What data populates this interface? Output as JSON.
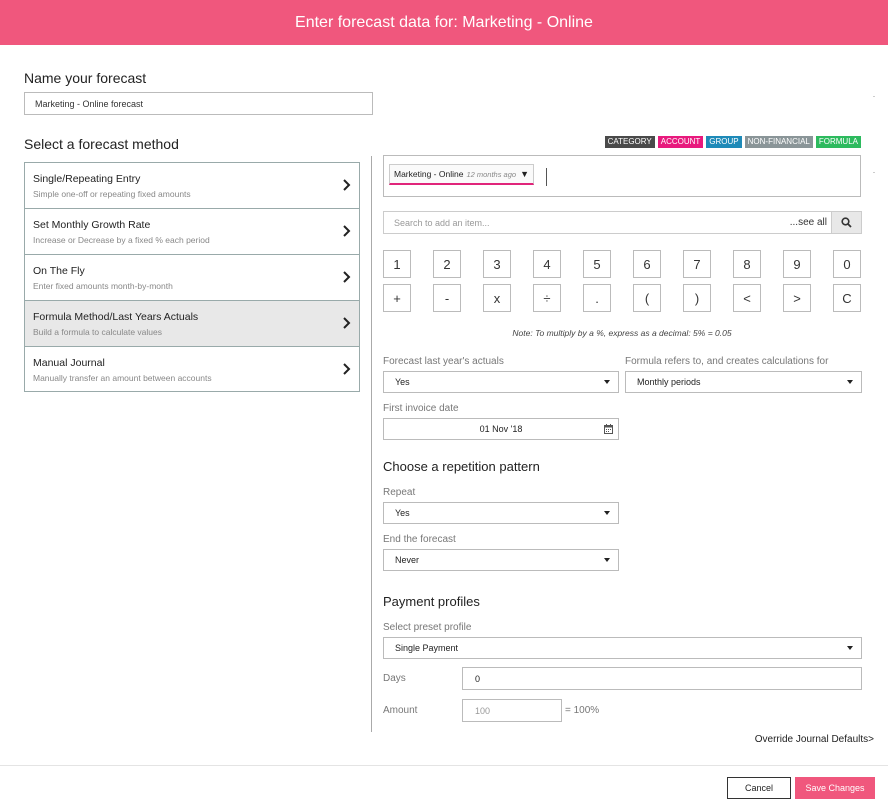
{
  "header": {
    "title": "Enter forecast data for: Marketing - Online"
  },
  "name_section": {
    "label": "Name your forecast",
    "value": "Marketing  - Online forecast"
  },
  "method_section": {
    "label": "Select a forecast method",
    "methods": [
      {
        "title": "Single/Repeating Entry",
        "subtitle": "Simple one-off or repeating fixed amounts"
      },
      {
        "title": "Set Monthly Growth Rate",
        "subtitle": "Increase or Decrease by a fixed % each period"
      },
      {
        "title": "On The Fly",
        "subtitle": "Enter fixed amounts month-by-month"
      },
      {
        "title": "Formula Method/Last Years Actuals",
        "subtitle": "Build a formula to calculate values"
      },
      {
        "title": "Manual Journal",
        "subtitle": "Manually transfer an amount between accounts"
      }
    ],
    "selected_index": 3
  },
  "tags": [
    {
      "label": "CATEGORY",
      "color": "#4a4a4a"
    },
    {
      "label": "ACCOUNT",
      "color": "#e8197d"
    },
    {
      "label": "GROUP",
      "color": "#1e8ab8"
    },
    {
      "label": "NON-FINANCIAL",
      "color": "#8a9598"
    },
    {
      "label": "FORMULA",
      "color": "#2dba5e"
    }
  ],
  "formula": {
    "account": "Marketing - Online",
    "ago": "12 months ago"
  },
  "search": {
    "placeholder": "Search to add an item...",
    "see_all": "...see all"
  },
  "keypad": {
    "row1": [
      "1",
      "2",
      "3",
      "4",
      "5",
      "6",
      "7",
      "8",
      "9",
      "0"
    ],
    "row2": [
      "+",
      "-",
      "x",
      "÷",
      ".",
      "(",
      ")",
      "<",
      ">",
      "C"
    ]
  },
  "note": "Note: To multiply by a %, express as a decimal: 5% = 0.05",
  "forecast_last_year": {
    "label": "Forecast last year's actuals",
    "value": "Yes"
  },
  "formula_refers": {
    "label": "Formula refers to, and creates calculations for",
    "value": "Monthly periods"
  },
  "first_invoice": {
    "label": "First invoice date",
    "value": "01 Nov '18"
  },
  "repetition": {
    "heading": "Choose a repetition pattern",
    "repeat_label": "Repeat",
    "repeat_value": "Yes",
    "end_label": "End the forecast",
    "end_value": "Never"
  },
  "payment": {
    "heading": "Payment profiles",
    "preset_label": "Select preset profile",
    "preset_value": "Single Payment",
    "days_label": "Days",
    "days_value": "0",
    "amount_label": "Amount",
    "amount_placeholder": "100",
    "amount_suffix": "= 100%"
  },
  "override": "Override Journal Defaults>",
  "buttons": {
    "cancel": "Cancel",
    "save": "Save Changes"
  },
  "colors": {
    "brand": "#f0577d",
    "account_underline": "#e0247a"
  }
}
